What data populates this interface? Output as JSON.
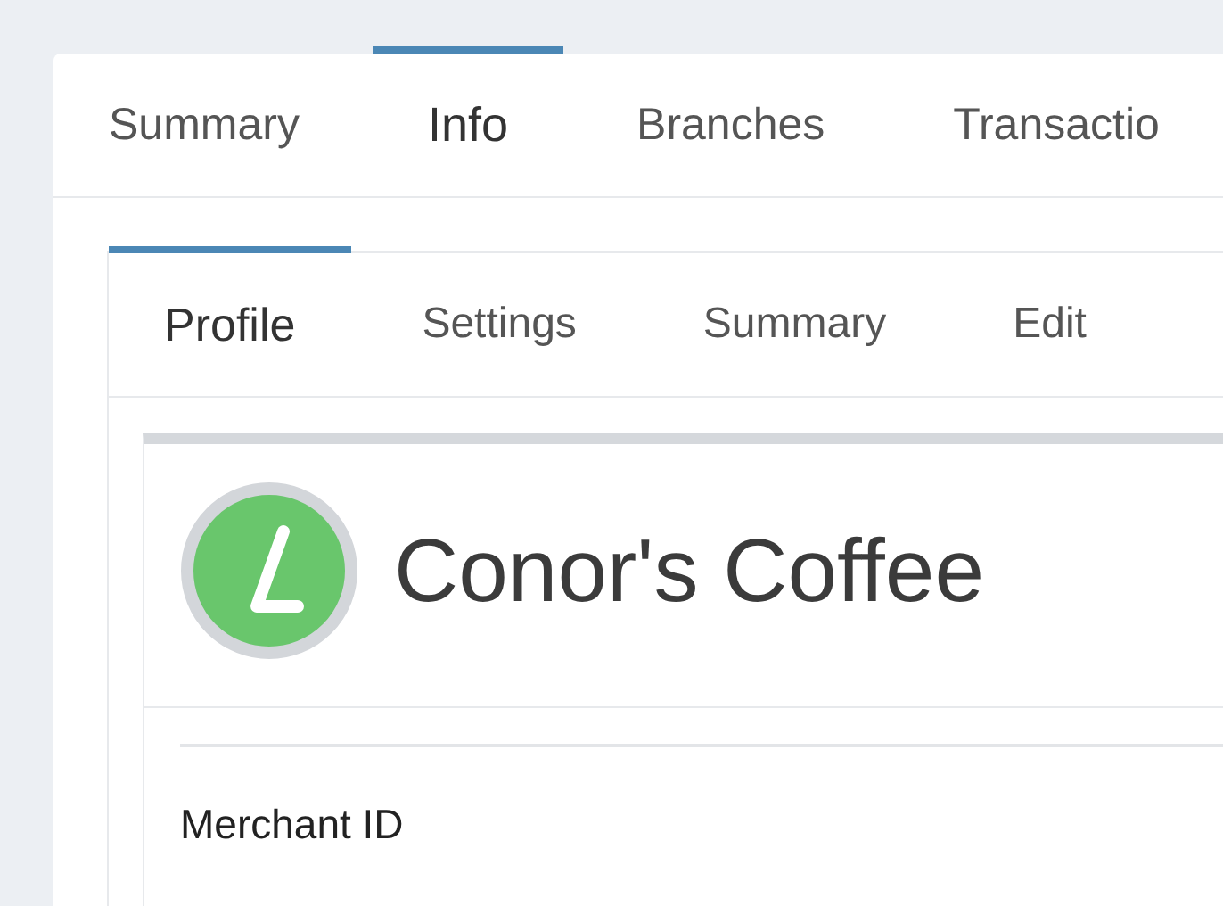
{
  "main_tabs": [
    {
      "label": "Summary",
      "selected": false
    },
    {
      "label": "Info",
      "selected": true
    },
    {
      "label": "Branches",
      "selected": false
    },
    {
      "label": "Transactio",
      "selected": false
    }
  ],
  "sub_tabs": [
    {
      "label": "Profile",
      "selected": true
    },
    {
      "label": "Settings",
      "selected": false
    },
    {
      "label": "Summary",
      "selected": false
    },
    {
      "label": "Edit",
      "selected": false
    }
  ],
  "profile": {
    "name": "Conor's Coffee",
    "fields": [
      {
        "label": "Merchant ID"
      }
    ]
  }
}
